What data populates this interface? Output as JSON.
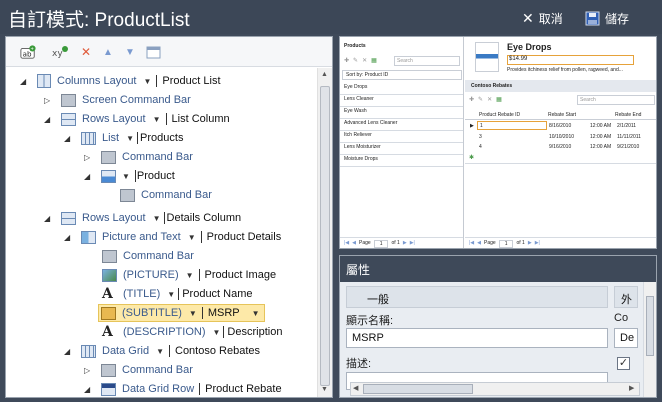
{
  "titlebar": {
    "title": "自訂模式: ProductList",
    "cancel_label": "取消",
    "save_label": "儲存"
  },
  "tree": [
    {
      "label": "Columns Layout",
      "value": "Product List",
      "icon": "columns-layout-icon"
    },
    {
      "label": "Screen Command Bar",
      "icon": "command-bar-icon"
    },
    {
      "label": "Rows Layout",
      "value": "List Column",
      "icon": "rows-layout-icon"
    },
    {
      "label": "List",
      "value": "Products",
      "icon": "list-icon"
    },
    {
      "label": "Command Bar",
      "icon": "command-bar-icon"
    },
    {
      "label": "",
      "value": "Product",
      "icon": "product-summary-icon"
    },
    {
      "label": "Command Bar",
      "icon": "command-bar-icon"
    },
    {
      "label": "Rows Layout",
      "value": "Details Column",
      "icon": "rows-layout-icon"
    },
    {
      "label": "Picture and Text",
      "value": "Product Details",
      "icon": "picture-and-text-icon"
    },
    {
      "label": "Command Bar",
      "icon": "command-bar-icon"
    },
    {
      "label": "(PICTURE)",
      "value": "Product Image",
      "icon": "image-icon"
    },
    {
      "label": "(TITLE)",
      "value": "Product Name",
      "icon": "text-icon"
    },
    {
      "label": "(SUBTITLE)",
      "value": "MSRP",
      "icon": "money-icon"
    },
    {
      "label": "(DESCRIPTION)",
      "value": "Description",
      "icon": "text-icon"
    },
    {
      "label": "Data Grid",
      "value": "Contoso Rebates",
      "icon": "data-grid-icon"
    },
    {
      "label": "Command Bar",
      "icon": "command-bar-icon"
    },
    {
      "label": "Data Grid Row",
      "value": "Product Rebate",
      "icon": "data-grid-row-icon"
    }
  ],
  "preview": {
    "list_title": "Products",
    "search_placeholder": "Search",
    "sort_label": "Sort by: Product ID",
    "products": [
      "Eye Drops",
      "Lens Cleaner",
      "Eye Wash",
      "Advanced Lens Cleaner",
      "Itch Reliever",
      "Lens Moisturizer",
      "Moisture Drops"
    ],
    "page_label": "Page",
    "page_num": "1",
    "page_of": "of 1",
    "detail_title": "Eye Drops",
    "detail_price": "$14.99",
    "detail_desc": "Provides itchiness relief from pollen, ragweed, and...",
    "rebates_title": "Contoso Rebates",
    "rebate_headers": [
      "Product Rebate ID",
      "Rebate Start",
      "Rebate End"
    ],
    "rebates": [
      [
        "1",
        "8/16/2010",
        "12:00 AM",
        "2/1/2011"
      ],
      [
        "3",
        "10/10/2010",
        "12:00 AM",
        "11/11/2011"
      ],
      [
        "4",
        "9/16/2010",
        "12:00 AM",
        "9/21/2010"
      ]
    ]
  },
  "props": {
    "title": "屬性",
    "section": "一般",
    "section2": "外",
    "display_name_label": "顯示名稱:",
    "display_name_value": "MSRP",
    "desc_label": "描述:",
    "col2_label": "Co",
    "col2_value": "De"
  }
}
